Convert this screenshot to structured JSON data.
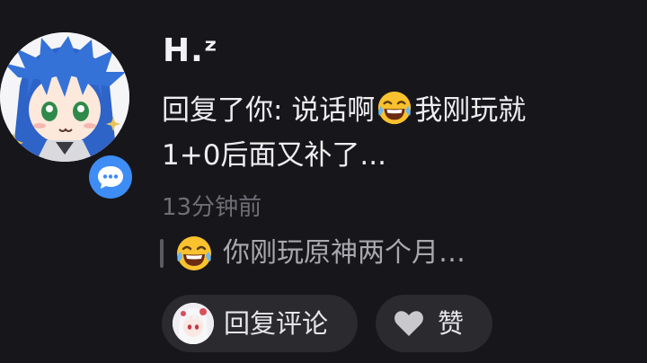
{
  "notification": {
    "username": "H.ᶻ",
    "reply_prefix": "回复了你: ",
    "reply_text_part1": "说话啊",
    "reply_text_part2": "我刚玩就1+0后面又补了...",
    "timestamp": "13分钟前",
    "quoted_comment": "你刚玩原神两个月…",
    "actions": {
      "reply_label": "回复评论",
      "like_label": "赞"
    },
    "icons": {
      "avatar": "anime-avatar-icon",
      "badge": "comment-bubble-icon",
      "emoji": "laughing-crying-emoji-icon",
      "like": "heart-icon"
    },
    "colors": {
      "background": "#17161b",
      "badge": "#3d8df5",
      "pill": "#2a2a2f",
      "timestamp": "#6e6e75",
      "quote_text": "#a8a8ae"
    }
  }
}
